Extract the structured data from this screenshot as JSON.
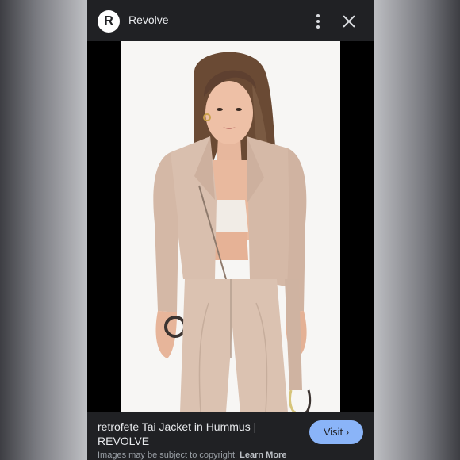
{
  "header": {
    "logo_letter": "R",
    "site_name": "Revolve",
    "more_icon": "more-vert-icon",
    "close_icon": "close-icon"
  },
  "image": {
    "subject": "retrofete Tai Jacket in Hummus"
  },
  "caption": {
    "title_line1": "retrofete Tai Jacket in Hummus |",
    "title_line2": "REVOLVE",
    "visit_label": "Visit",
    "visit_chevron": "›",
    "copyright_text": "Images may be subject to copyright.",
    "learn_more": "Learn More"
  },
  "colors": {
    "chrome_bg": "#202124",
    "visit_button": "#8ab4f8",
    "jacket": "#d9bfae"
  }
}
